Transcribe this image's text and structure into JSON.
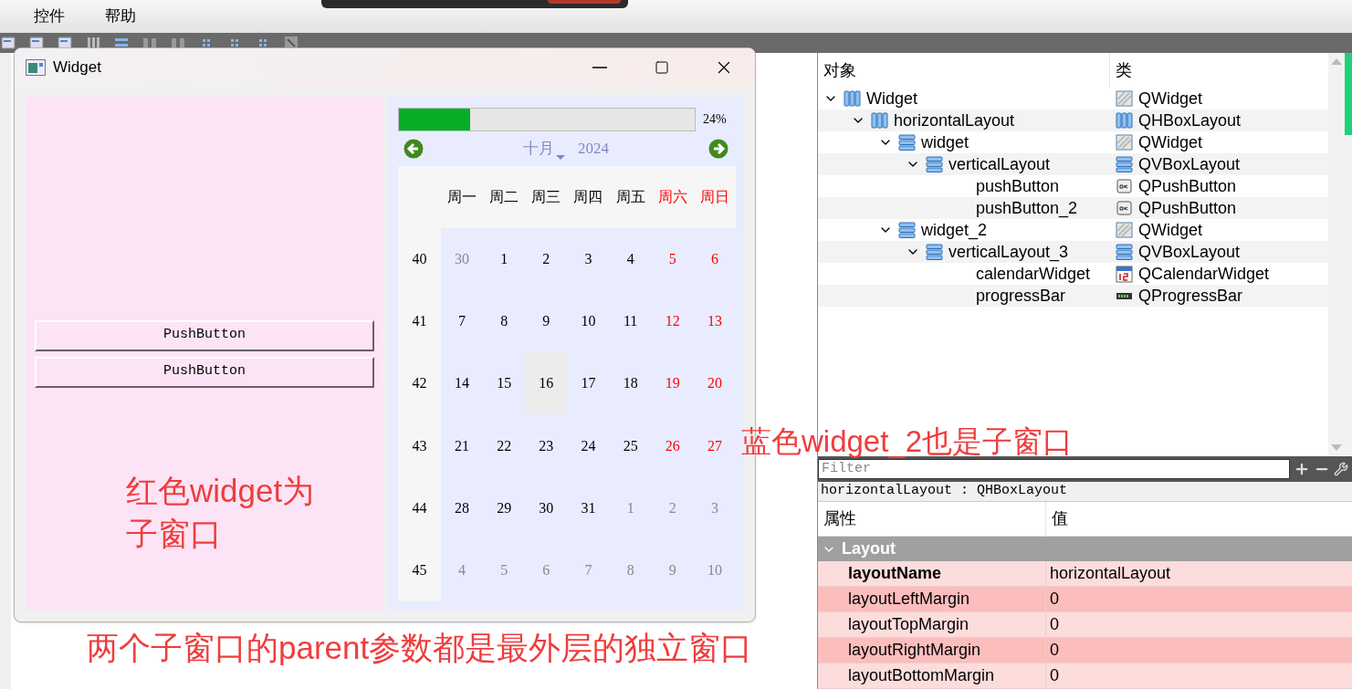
{
  "menu_bar": {
    "items": [
      "控件",
      "帮助"
    ]
  },
  "form_window": {
    "title": "Widget",
    "left_panel": {
      "buttons": [
        "PushButton",
        "PushButton"
      ]
    },
    "right_panel": {
      "progress": {
        "level": 0.24,
        "reading": "24%"
      },
      "calendar": {
        "month": "十月",
        "year": "2024",
        "weekdays": [
          {
            "text": "周一",
            "kind": "weekday"
          },
          {
            "text": "周二",
            "kind": "weekday"
          },
          {
            "text": "周三",
            "kind": "weekday"
          },
          {
            "text": "周四",
            "kind": "weekday"
          },
          {
            "text": "周五",
            "kind": "weekday"
          },
          {
            "text": "周六",
            "kind": "weekend"
          },
          {
            "text": "周日",
            "kind": "weekend"
          }
        ],
        "weeks": [
          {
            "number": "40",
            "days": [
              {
                "text": "30",
                "kind": "other",
                "selected": false
              },
              {
                "text": "1",
                "kind": "weekday",
                "selected": false
              },
              {
                "text": "2",
                "kind": "weekday",
                "selected": false
              },
              {
                "text": "3",
                "kind": "weekday",
                "selected": false
              },
              {
                "text": "4",
                "kind": "weekday",
                "selected": false
              },
              {
                "text": "5",
                "kind": "weekend",
                "selected": false
              },
              {
                "text": "6",
                "kind": "weekend",
                "selected": false
              }
            ]
          },
          {
            "number": "41",
            "days": [
              {
                "text": "7",
                "kind": "weekday",
                "selected": false
              },
              {
                "text": "8",
                "kind": "weekday",
                "selected": false
              },
              {
                "text": "9",
                "kind": "weekday",
                "selected": false
              },
              {
                "text": "10",
                "kind": "weekday",
                "selected": false
              },
              {
                "text": "11",
                "kind": "weekday",
                "selected": false
              },
              {
                "text": "12",
                "kind": "weekend",
                "selected": false
              },
              {
                "text": "13",
                "kind": "weekend",
                "selected": false
              }
            ]
          },
          {
            "number": "42",
            "days": [
              {
                "text": "14",
                "kind": "weekday",
                "selected": false
              },
              {
                "text": "15",
                "kind": "weekday",
                "selected": false
              },
              {
                "text": "16",
                "kind": "weekday",
                "selected": true
              },
              {
                "text": "17",
                "kind": "weekday",
                "selected": false
              },
              {
                "text": "18",
                "kind": "weekday",
                "selected": false
              },
              {
                "text": "19",
                "kind": "weekend",
                "selected": false
              },
              {
                "text": "20",
                "kind": "weekend",
                "selected": false
              }
            ]
          },
          {
            "number": "43",
            "days": [
              {
                "text": "21",
                "kind": "weekday",
                "selected": false
              },
              {
                "text": "22",
                "kind": "weekday",
                "selected": false
              },
              {
                "text": "23",
                "kind": "weekday",
                "selected": false
              },
              {
                "text": "24",
                "kind": "weekday",
                "selected": false
              },
              {
                "text": "25",
                "kind": "weekday",
                "selected": false
              },
              {
                "text": "26",
                "kind": "weekend",
                "selected": false
              },
              {
                "text": "27",
                "kind": "weekend",
                "selected": false
              }
            ]
          },
          {
            "number": "44",
            "days": [
              {
                "text": "28",
                "kind": "weekday",
                "selected": false
              },
              {
                "text": "29",
                "kind": "weekday",
                "selected": false
              },
              {
                "text": "30",
                "kind": "weekday",
                "selected": false
              },
              {
                "text": "31",
                "kind": "weekday",
                "selected": false
              },
              {
                "text": "1",
                "kind": "other",
                "selected": false
              },
              {
                "text": "2",
                "kind": "other",
                "selected": false
              },
              {
                "text": "3",
                "kind": "other",
                "selected": false
              }
            ]
          },
          {
            "number": "45",
            "days": [
              {
                "text": "4",
                "kind": "other",
                "selected": false
              },
              {
                "text": "5",
                "kind": "other",
                "selected": false
              },
              {
                "text": "6",
                "kind": "other",
                "selected": false
              },
              {
                "text": "7",
                "kind": "other",
                "selected": false
              },
              {
                "text": "8",
                "kind": "other",
                "selected": false
              },
              {
                "text": "9",
                "kind": "other",
                "selected": false
              },
              {
                "text": "10",
                "kind": "other",
                "selected": false
              }
            ]
          }
        ]
      }
    }
  },
  "annotations": {
    "left": "红色widget为子窗口",
    "right": "蓝色widget_2也是子窗口",
    "bottom": "两个子窗口的parent参数都是最外层的独立窗口"
  },
  "object_inspector": {
    "columns": [
      "对象",
      "类"
    ],
    "tree": [
      {
        "name": "Widget",
        "class": "QWidget",
        "kind": "widget",
        "expanded": true,
        "children": [
          {
            "name": "horizontalLayout",
            "class": "QHBoxLayout",
            "kind": "hbox",
            "expanded": true,
            "children": [
              {
                "name": "widget",
                "class": "QWidget",
                "kind": "widget",
                "expanded": true,
                "children": [
                  {
                    "name": "verticalLayout",
                    "class": "QVBoxLayout",
                    "kind": "vbox",
                    "expanded": true,
                    "children": [
                      {
                        "name": "pushButton",
                        "class": "QPushButton",
                        "kind": "button"
                      },
                      {
                        "name": "pushButton_2",
                        "class": "QPushButton",
                        "kind": "button"
                      }
                    ]
                  }
                ]
              },
              {
                "name": "widget_2",
                "class": "QWidget",
                "kind": "widget",
                "expanded": true,
                "children": [
                  {
                    "name": "verticalLayout_3",
                    "class": "QVBoxLayout",
                    "kind": "vbox",
                    "expanded": true,
                    "children": [
                      {
                        "name": "calendarWidget",
                        "class": "QCalendarWidget",
                        "kind": "calendar"
                      },
                      {
                        "name": "progressBar",
                        "class": "QProgressBar",
                        "kind": "progress"
                      }
                    ]
                  }
                ]
              }
            ]
          }
        ]
      }
    ]
  },
  "property_editor": {
    "filter_placeholder": "Filter",
    "object_label": "horizontalLayout : QHBoxLayout",
    "columns": [
      "属性",
      "值"
    ],
    "groups": [
      {
        "name": "Layout",
        "expanded": true,
        "properties": [
          {
            "name": "layoutName",
            "value": "horizontalLayout",
            "modified": true
          },
          {
            "name": "layoutLeftMargin",
            "value": "0",
            "modified": false
          },
          {
            "name": "layoutTopMargin",
            "value": "0",
            "modified": false
          },
          {
            "name": "layoutRightMargin",
            "value": "0",
            "modified": false
          },
          {
            "name": "layoutBottomMargin",
            "value": "0",
            "modified": false
          }
        ]
      }
    ]
  }
}
